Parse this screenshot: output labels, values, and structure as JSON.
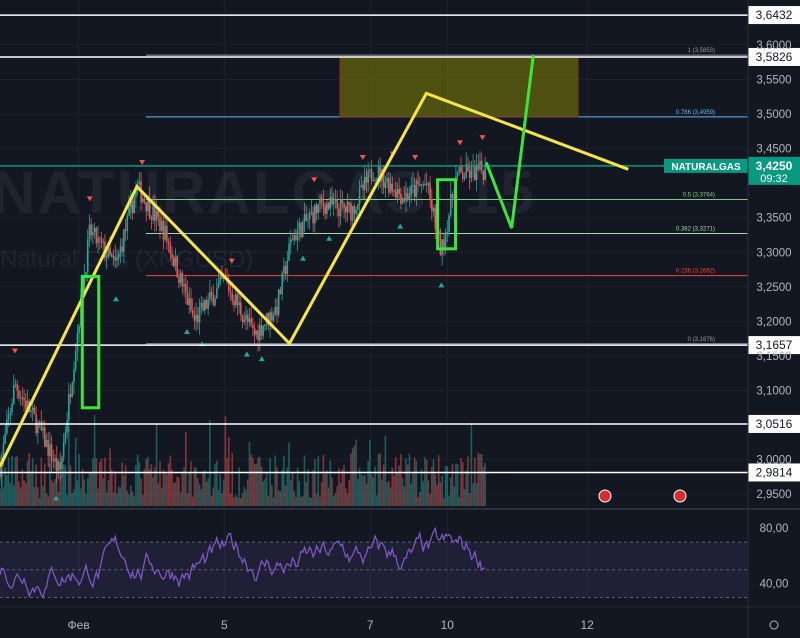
{
  "chart_data": {
    "type": "candlestick",
    "symbol": "NATURALGAS",
    "watermark": "NATURALGAS, 15",
    "watermark_sub": "Natural Gas (XNGUSD)",
    "last_price": "3,4250",
    "countdown": "09:32",
    "ylim": [
      2.93,
      3.665
    ],
    "y_ticks": [
      "3,6000",
      "3,5500",
      "3,5000",
      "3,4500",
      "3,3500",
      "3,3000",
      "3,2500",
      "3,2000",
      "3,1500",
      "3,1000",
      "3,0000",
      "2,9500"
    ],
    "y_tick_values": [
      3.6,
      3.55,
      3.5,
      3.45,
      3.35,
      3.3,
      3.25,
      3.2,
      3.15,
      3.1,
      3.0,
      2.95
    ],
    "x_ticks": [
      "Фев",
      "5",
      "7",
      "10",
      "12"
    ],
    "x_tick_positions": [
      0.105,
      0.3,
      0.495,
      0.598,
      0.785
    ],
    "horizontal_levels": [
      {
        "value": 3.6432,
        "label": "3,6432"
      },
      {
        "value": 3.5826,
        "label": "3,5826"
      },
      {
        "value": 3.1657,
        "label": "3,1657"
      },
      {
        "value": 3.0516,
        "label": "3,0516"
      },
      {
        "value": 2.9814,
        "label": "2,9814"
      }
    ],
    "fib_levels": [
      {
        "ratio": "1",
        "value": 3.5853,
        "label": "1 (3,5853)",
        "color": "#9598a1"
      },
      {
        "ratio": "0.786",
        "value": 3.4959,
        "label": "0.786 (3,4959)",
        "color": "#64b5f6"
      },
      {
        "ratio": "0.5",
        "value": 3.3764,
        "label": "0.5 (3,3764)",
        "color": "#81c784"
      },
      {
        "ratio": "0.382",
        "value": 3.3271,
        "label": "0.382 (3,3271)",
        "color": "#a5d6a7"
      },
      {
        "ratio": "0.236",
        "value": 3.2662,
        "label": "0.236 (3,2662)",
        "color": "#f44336"
      },
      {
        "ratio": "0",
        "value": 3.1676,
        "label": "0 (3,1676)",
        "color": "#9598a1"
      }
    ],
    "current_price": 3.425,
    "target_zone": {
      "top": 3.5826,
      "bottom": 3.4959
    },
    "zigzag": [
      [
        0.0,
        2.99
      ],
      [
        0.183,
        3.395
      ],
      [
        0.387,
        3.168
      ],
      [
        0.57,
        3.53
      ],
      [
        0.84,
        3.42
      ]
    ],
    "projection": [
      [
        0.65,
        3.43
      ],
      [
        0.684,
        3.335
      ],
      [
        0.713,
        3.585
      ]
    ],
    "highlight_boxes": [
      {
        "x0": 0.11,
        "x1": 0.132,
        "top": 3.265,
        "bottom": 3.075
      },
      {
        "x0": 0.585,
        "x1": 0.609,
        "top": 3.405,
        "bottom": 3.305
      }
    ],
    "rsi": {
      "ylim": [
        26,
        91
      ],
      "y_ticks": [
        "80,00",
        "40,00"
      ],
      "y_tick_values": [
        80,
        40
      ],
      "upper": 70,
      "lower": 30
    }
  },
  "colors": {
    "background": "#131722",
    "grid": "#1e222d",
    "up": "#26a69a",
    "down": "#ef5350",
    "zigzag": "#f5e642",
    "projection": "#39e639",
    "box": "#39e639",
    "rsi": "#7e57c2",
    "current": "#089981",
    "zone": "rgba(128,128,0,0.55)"
  },
  "icons": {
    "flag": "us-flag-icon",
    "settings": "clock-settings-icon"
  }
}
